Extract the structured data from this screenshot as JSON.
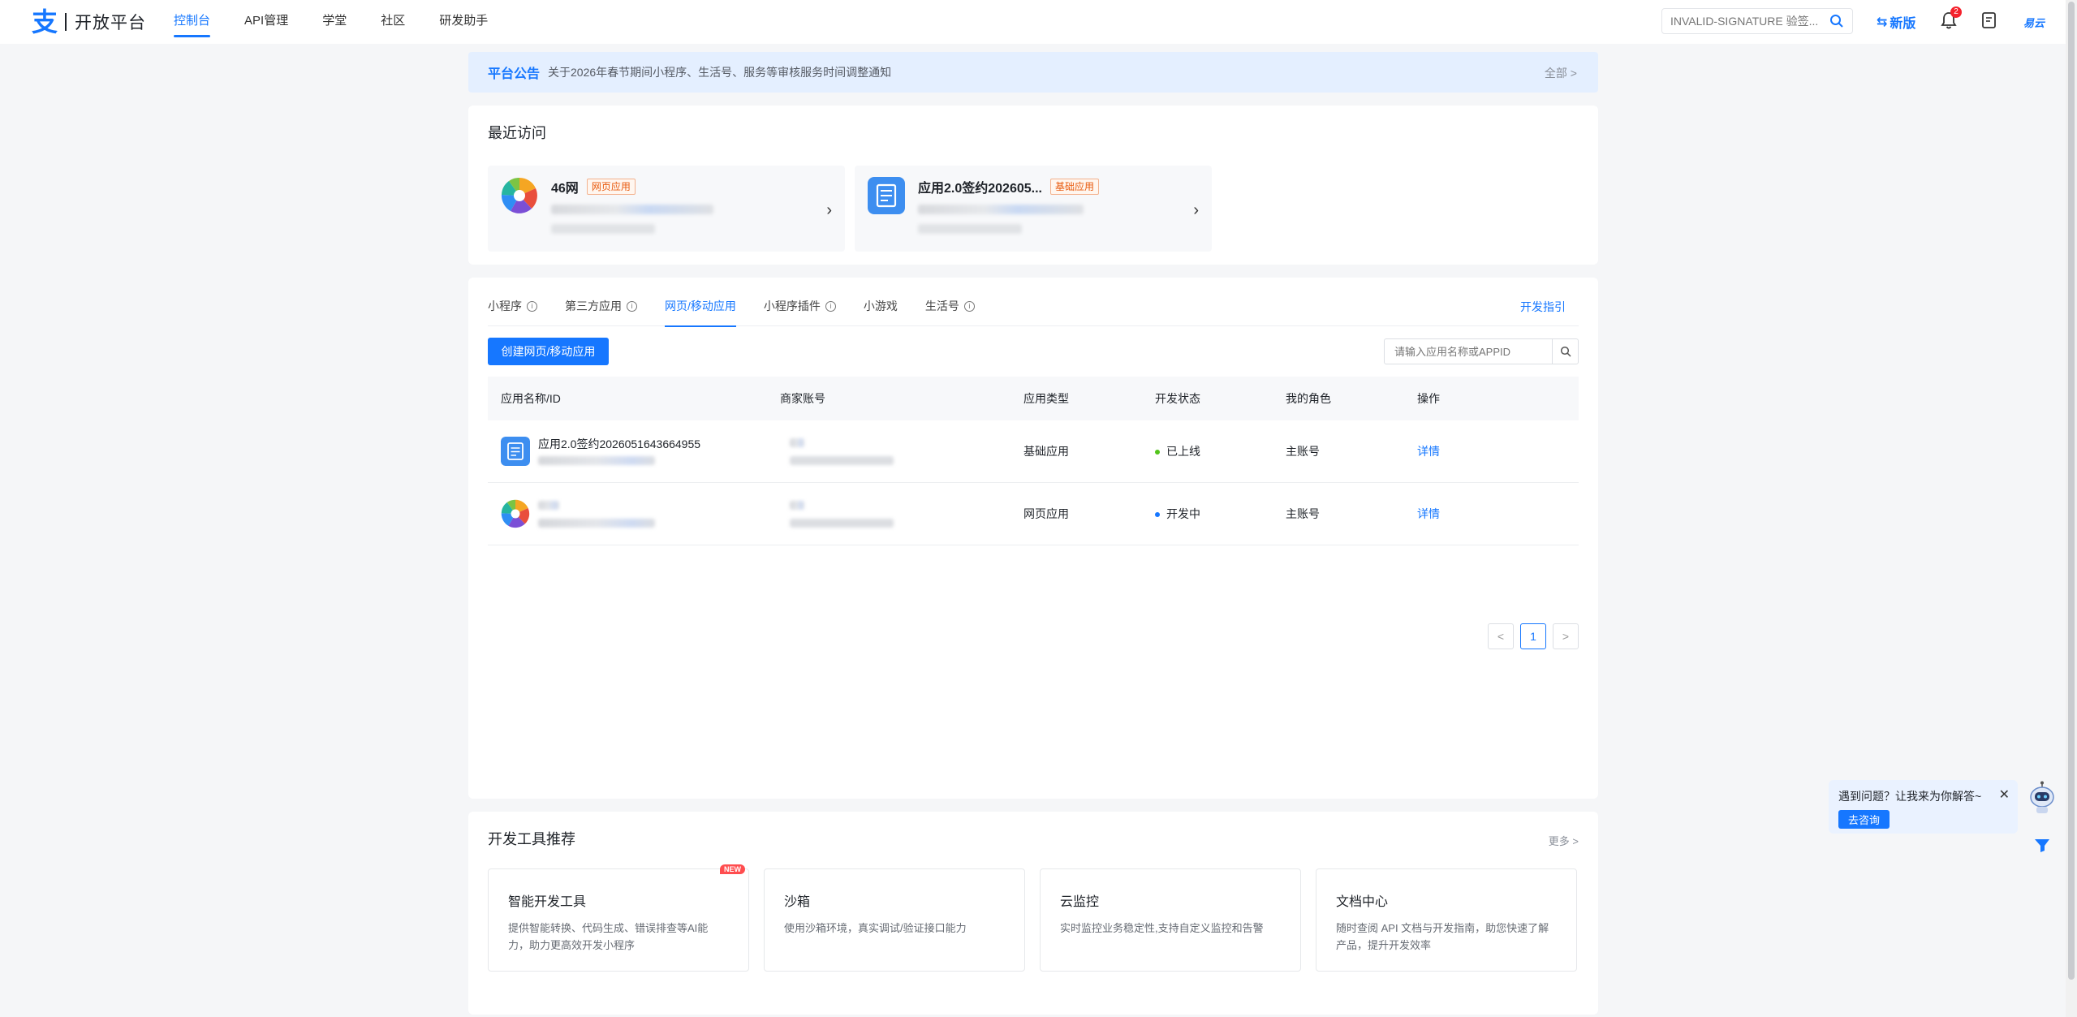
{
  "brand": {
    "logo_glyph": "支",
    "title": "开放平台"
  },
  "nav": [
    {
      "label": "控制台",
      "active": true
    },
    {
      "label": "API管理",
      "active": false
    },
    {
      "label": "学堂",
      "active": false
    },
    {
      "label": "社区",
      "active": false
    },
    {
      "label": "研发助手",
      "active": false
    }
  ],
  "top_search": {
    "placeholder": "INVALID-SIGNATURE 验签..."
  },
  "new_version": "新版",
  "notifications": {
    "count": "2"
  },
  "user": {
    "name": "易云"
  },
  "notice": {
    "tag": "平台公告",
    "text": "关于2026年春节期间小程序、生活号、服务等审核服务时间调整通知",
    "all": "全部 >"
  },
  "recent": {
    "title": "最近访问",
    "items": [
      {
        "name": "46网",
        "tag": "网页应用"
      },
      {
        "name": "应用2.0签约202605...",
        "tag": "基础应用"
      }
    ]
  },
  "apps": {
    "tabs": [
      {
        "label": "小程序",
        "info": true,
        "active": false
      },
      {
        "label": "第三方应用",
        "info": true,
        "active": false
      },
      {
        "label": "网页/移动应用",
        "info": false,
        "active": true
      },
      {
        "label": "小程序插件",
        "info": true,
        "active": false
      },
      {
        "label": "小游戏",
        "info": false,
        "active": false
      },
      {
        "label": "生活号",
        "info": true,
        "active": false
      }
    ],
    "dev_guide": "开发指引",
    "create_button": "创建网页/移动应用",
    "search_placeholder": "请输入应用名称或APPID",
    "columns": [
      "应用名称/ID",
      "商家账号",
      "应用类型",
      "开发状态",
      "我的角色",
      "操作"
    ],
    "rows": [
      {
        "name": "应用2.0签约2026051643664955",
        "type": "基础应用",
        "status": "已上线",
        "status_color": "#52c41a",
        "role": "主账号",
        "action": "详情"
      },
      {
        "name": "",
        "type": "网页应用",
        "status": "开发中",
        "status_color": "#1677ff",
        "role": "主账号",
        "action": "详情"
      }
    ],
    "pager": {
      "prev": "<",
      "current": "1",
      "next": ">"
    }
  },
  "tools": {
    "title": "开发工具推荐",
    "more": "更多 >",
    "items": [
      {
        "name": "智能开发工具",
        "desc": "提供智能转换、代码生成、错误排查等AI能力，助力更高效开发小程序",
        "badge": "NEW"
      },
      {
        "name": "沙箱",
        "desc": "使用沙箱环境，真实调试/验证接口能力",
        "badge": ""
      },
      {
        "name": "云监控",
        "desc": "实时监控业务稳定性,支持自定义监控和告警",
        "badge": ""
      },
      {
        "name": "文档中心",
        "desc": "随时查阅 API 文档与开发指南，助您快速了解产品，提升开发效率",
        "badge": ""
      }
    ]
  },
  "help": {
    "text": "遇到问题？让我来为你解答~",
    "button": "去咨询",
    "close": "✕"
  },
  "colors": {
    "accent": "#1677ff",
    "notice_bg": "#e4efff",
    "tag_orange": "#e8590c"
  }
}
